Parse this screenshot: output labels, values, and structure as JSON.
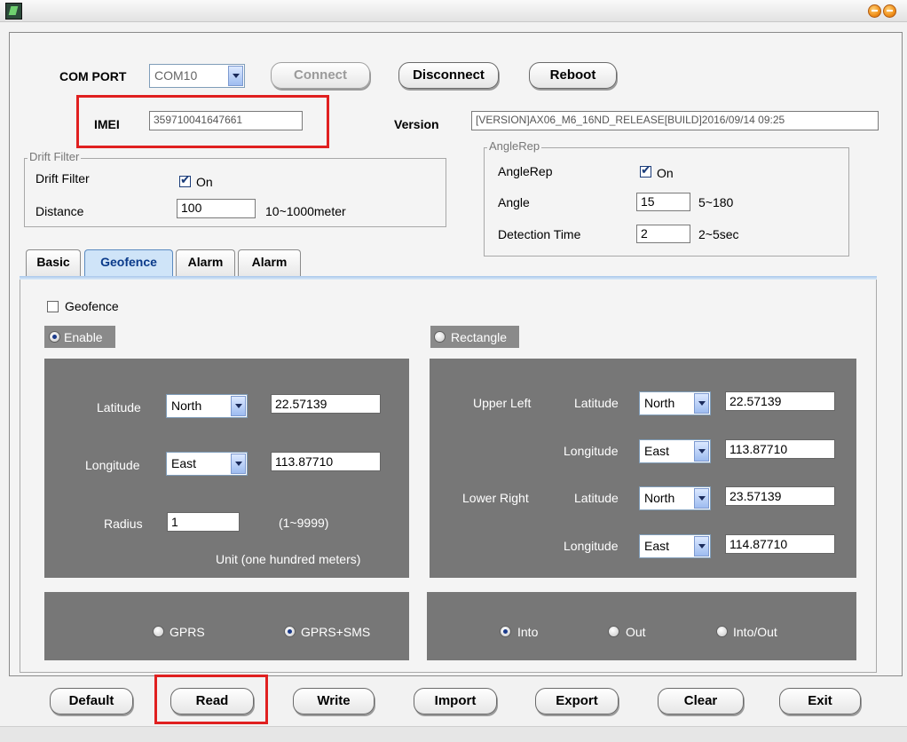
{
  "window": {
    "controls": [
      "minimize-icon",
      "close-icon"
    ]
  },
  "top": {
    "com_port_label": "COM PORT",
    "com_port_value": "COM10",
    "connect_label": "Connect",
    "disconnect_label": "Disconnect",
    "reboot_label": "Reboot",
    "imei_label": "IMEI",
    "imei_value": "359710041647661",
    "version_label": "Version",
    "version_value": "[VERSION]AX06_M6_16ND_RELEASE[BUILD]2016/09/14 09:25"
  },
  "drift_filter": {
    "legend": "Drift Filter",
    "label": "Drift Filter",
    "checked": true,
    "on_label": "On",
    "distance_label": "Distance",
    "distance_value": "100",
    "distance_range": "10~1000meter"
  },
  "angle_rep": {
    "legend": "AngleRep",
    "label": "AngleRep",
    "checked": true,
    "on_label": "On",
    "angle_label": "Angle",
    "angle_value": "15",
    "angle_range": "5~180",
    "detection_label": "Detection Time",
    "detection_value": "2",
    "detection_range": "2~5sec"
  },
  "tabs": [
    {
      "label": "Basic",
      "active": false
    },
    {
      "label": "Geofence",
      "active": true
    },
    {
      "label": "Alarm",
      "active": false
    },
    {
      "label": "Alarm",
      "active": false
    }
  ],
  "geofence": {
    "checkbox_label": "Geofence",
    "checked": false,
    "enable_label": "Enable",
    "enable_selected": true,
    "rectangle_label": "Rectangle",
    "rectangle_selected": false,
    "circle": {
      "latitude_label": "Latitude",
      "latitude_dir": "North",
      "latitude_value": "22.57139",
      "longitude_label": "Longitude",
      "longitude_dir": "East",
      "longitude_value": "113.87710",
      "radius_label": "Radius",
      "radius_value": "1",
      "radius_range": "(1~9999)",
      "unit_text": "Unit (one hundred meters)"
    },
    "rect": {
      "upper_left_label": "Upper Left",
      "lower_right_label": "Lower Right",
      "latitude_label": "Latitude",
      "longitude_label": "Longitude",
      "ul_lat_dir": "North",
      "ul_lat_value": "22.57139",
      "ul_lon_dir": "East",
      "ul_lon_value": "113.87710",
      "lr_lat_dir": "North",
      "lr_lat_value": "23.57139",
      "lr_lon_dir": "East",
      "lr_lon_value": "114.87710"
    },
    "notify": {
      "gprs_label": "GPRS",
      "gprs_sms_label": "GPRS+SMS",
      "selected": "GPRS+SMS"
    },
    "direction": {
      "into_label": "Into",
      "out_label": "Out",
      "into_out_label": "Into/Out",
      "selected": "Into"
    }
  },
  "buttons": {
    "default_label": "Default",
    "read_label": "Read",
    "write_label": "Write",
    "import_label": "Import",
    "export_label": "Export",
    "clear_label": "Clear",
    "exit_label": "Exit"
  },
  "highlight_color": "#e02020"
}
